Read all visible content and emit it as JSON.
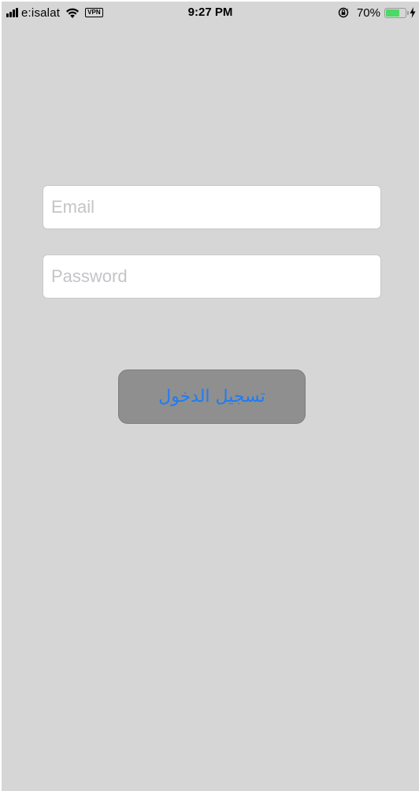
{
  "status_bar": {
    "carrier": "e:isalat",
    "vpn": "VPN",
    "time": "9:27 PM",
    "battery_percent": "70%",
    "battery_level": 0.7,
    "battery_color": "#4cd964"
  },
  "login_form": {
    "email_placeholder": "Email",
    "email_value": "",
    "password_placeholder": "Password",
    "password_value": "",
    "login_label": "تسجيل الدخول",
    "login_text_color": "#1e7cf5",
    "login_bg_color": "#8f8f8f"
  },
  "background_color": "#d6d6d6"
}
